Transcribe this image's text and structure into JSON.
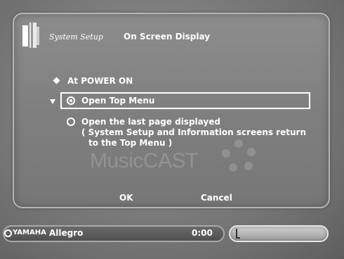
{
  "header": {
    "app_label": "System Setup",
    "screen_title": "On Screen Display"
  },
  "setting": {
    "heading": "At POWER ON",
    "options": [
      {
        "label": "Open Top Menu",
        "selected": true
      },
      {
        "label": "Open the last page displayed",
        "selected": false,
        "note_line1": "( System Setup and Information screens return",
        "note_line2": "to the Top Menu )"
      }
    ]
  },
  "watermark": "MusicCAST",
  "buttons": {
    "ok": "OK",
    "cancel": "Cancel"
  },
  "status": {
    "brand": "YAMAHA",
    "track": "Allegro",
    "time": "0:00",
    "level": 0.04
  },
  "icons": [
    "setup-logo-icon",
    "diamond-bullet-icon",
    "cursor-arrow-icon",
    "radio-icon",
    "yamaha-logo-icon"
  ]
}
